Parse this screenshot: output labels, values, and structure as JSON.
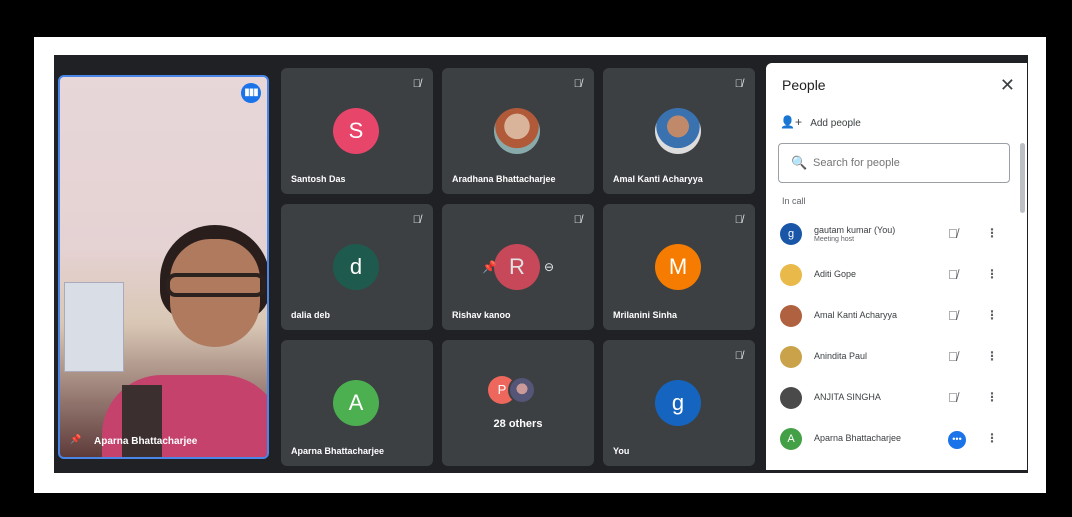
{
  "featured": {
    "name": "Aparna Bhattacharjee"
  },
  "tiles": [
    {
      "name": "Santosh Das",
      "initial": "S",
      "color": "#e8456b"
    },
    {
      "name": "Aradhana Bhattacharjee"
    },
    {
      "name": "Amal Kanti Acharyya"
    },
    {
      "name": "dalia deb",
      "initial": "d",
      "color": "#1e5b4e"
    },
    {
      "name": "Rishav kanoo",
      "initial": "R",
      "color": "#e04a5c"
    },
    {
      "name": "Mrilanini Sinha",
      "initial": "M",
      "color": "#f57c00"
    },
    {
      "name": "Aparna Bhattacharjee",
      "initial": "A",
      "color": "#4caf50"
    },
    {
      "initial": "P",
      "others": "28 others"
    },
    {
      "name": "You",
      "initial": "g",
      "color": "#1565c0"
    }
  ],
  "panel": {
    "title": "People",
    "add_people_label": "Add people",
    "search_placeholder": "Search for people",
    "section_label": "In call",
    "participants": [
      {
        "name": "gautam kumar (You)",
        "sub": "Meeting host",
        "initial": "g",
        "color": "#1a56a8"
      },
      {
        "name": "Aditi Gope",
        "color": "#e9b949"
      },
      {
        "name": "Amal Kanti Acharyya",
        "color": "#b0613f"
      },
      {
        "name": "Anindita Paul",
        "color": "#c9a24a"
      },
      {
        "name": "ANJITA SINGHA",
        "color": "#4a4a4a"
      },
      {
        "name": "Aparna Bhattacharjee",
        "initial": "A",
        "color": "#43a047",
        "speaking": true
      }
    ]
  },
  "icons": {
    "mic_off": "mic-off-icon",
    "more": "more-vert-icon",
    "close": "close-icon",
    "search": "search-icon",
    "add_person": "person-add-icon",
    "speaking": "audio-level-icon",
    "pin": "pin-icon"
  }
}
